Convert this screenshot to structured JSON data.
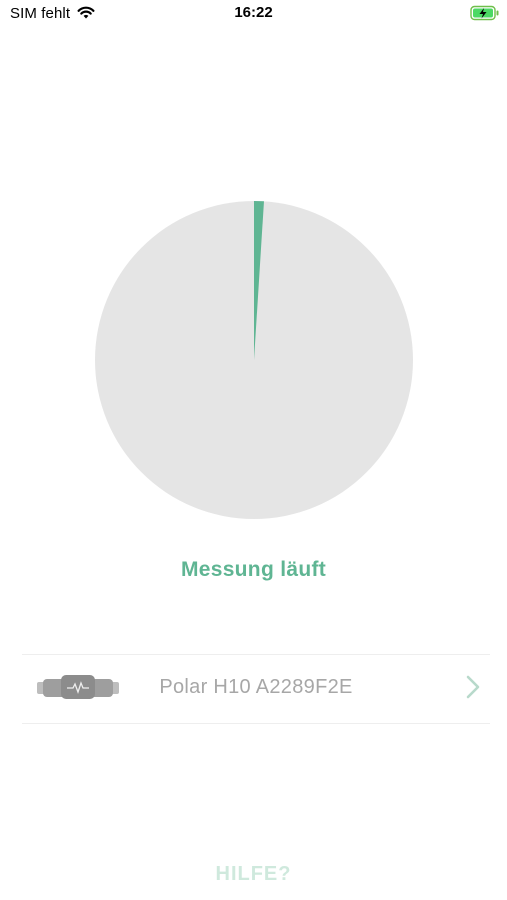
{
  "status_bar": {
    "carrier": "SIM fehlt",
    "time": "16:22",
    "wifi_icon": "wifi-icon",
    "battery_icon": "battery-charging-icon"
  },
  "measurement": {
    "progress_fraction": 0.01,
    "status": "Messung läuft",
    "colors": {
      "progress": "#5fb593",
      "track": "#e5e5e5",
      "status": "#5fb593"
    }
  },
  "device": {
    "name": "Polar H10 A2289F2E",
    "icon": "chest-strap-sensor-icon",
    "chevron_icon": "chevron-right-icon"
  },
  "help": {
    "label": "HILFE?"
  }
}
